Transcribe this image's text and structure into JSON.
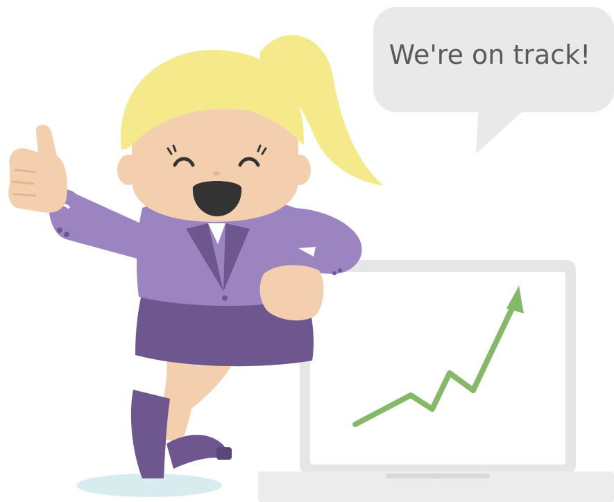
{
  "speech_bubble": {
    "text": "We're on track!"
  },
  "colors": {
    "bubble": "#e9e9e9",
    "hair": "#f4ea8c",
    "skin": "#f3cfae",
    "jacket": "#9c84c0",
    "skirt_and_shoes": "#6e568f",
    "laptop": "#e6e6e6",
    "trend_arrow": "#86b86a",
    "shadow": "#d8ecef"
  },
  "icons": [
    "speech-bubble",
    "cartoon-woman",
    "thumbs-up",
    "laptop",
    "upward-trend-arrow"
  ]
}
